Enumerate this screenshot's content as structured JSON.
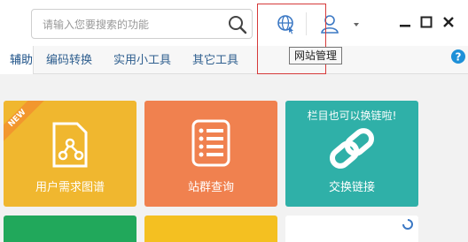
{
  "search": {
    "placeholder": "请输入您要搜索的功能",
    "value": ""
  },
  "toolbar": {
    "web_icon": "globe-icon",
    "user_icon": "user-icon",
    "dropdown_icon": "caret-down-icon"
  },
  "window": {
    "minimize_icon": "minimize-icon",
    "maximize_icon": "maximize-icon",
    "close_icon": "close-icon"
  },
  "tooltip": {
    "text": "网站管理"
  },
  "tabs": [
    {
      "label": "辅助",
      "active": true
    },
    {
      "label": "编码转换",
      "active": false
    },
    {
      "label": "实用小工具",
      "active": false
    },
    {
      "label": "其它工具",
      "active": false
    }
  ],
  "help": {
    "icon": "help-icon",
    "label": "?"
  },
  "tiles": [
    {
      "label": "用户需求图谱",
      "color": "#f0b72f",
      "icon": "graph-icon",
      "badge": "NEW"
    },
    {
      "label": "站群查询",
      "color": "#f0814f",
      "icon": "list-icon"
    },
    {
      "label": "交换链接",
      "color": "#2fb0a8",
      "icon": "link-icon",
      "note": "栏目也可以换链啦!"
    }
  ],
  "bottom_tiles": [
    {
      "color": "#21a85b"
    },
    {
      "color": "#f4c021"
    },
    {
      "color": "#ffffff",
      "icon": "spinner-icon"
    }
  ],
  "colors": {
    "accent": "#2f5f8f",
    "highlight": "#d63a3a",
    "help": "#1e90d8"
  }
}
